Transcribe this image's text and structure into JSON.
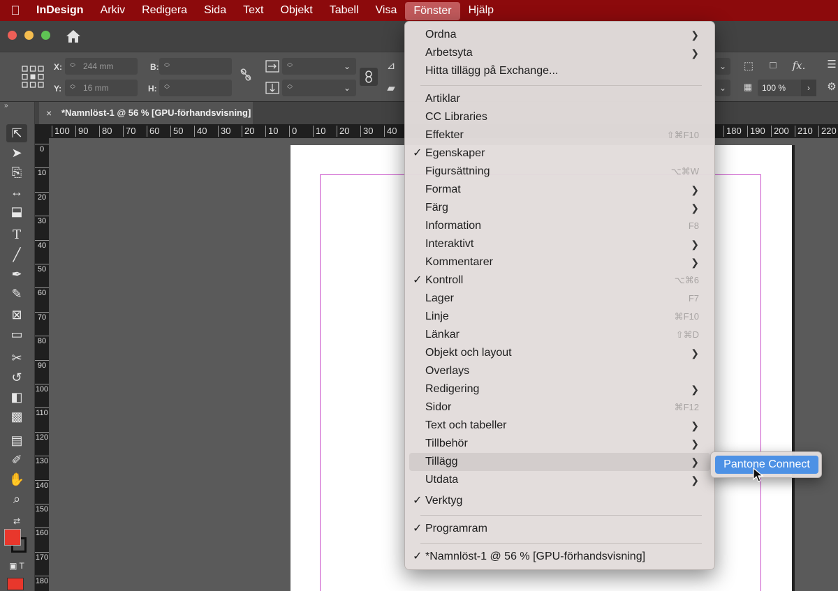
{
  "menubar": {
    "apple_icon": "apple-logo-icon",
    "app_name": "InDesign",
    "items": [
      "Arkiv",
      "Redigera",
      "Sida",
      "Text",
      "Objekt",
      "Tabell",
      "Visa",
      "Fönster",
      "Hjälp"
    ],
    "active": "Fönster"
  },
  "control": {
    "x_label": "X:",
    "x_value": "244 mm",
    "y_label": "Y:",
    "y_value": "16 mm",
    "b_label": "B:",
    "h_label": "H:",
    "zoom_value": "100 %"
  },
  "document_tab": {
    "close": "×",
    "title": "*Namnlöst-1 @ 56 % [GPU-förhandsvisning]"
  },
  "hruler": [
    "100",
    "90",
    "80",
    "70",
    "60",
    "50",
    "40",
    "30",
    "20",
    "10",
    "0",
    "10",
    "20",
    "30",
    "40",
    "180",
    "190",
    "200",
    "210",
    "220"
  ],
  "vruler": [
    "0",
    "10",
    "20",
    "30",
    "40",
    "50",
    "60",
    "70",
    "80",
    "90",
    "100",
    "110",
    "120",
    "130",
    "140",
    "150",
    "160",
    "170",
    "180"
  ],
  "window_menu": {
    "items": [
      {
        "label": "Ordna",
        "submenu": true
      },
      {
        "label": "Arbetsyta",
        "submenu": true
      },
      {
        "label": "Hitta tillägg på Exchange..."
      },
      {
        "label": "Artiklar"
      },
      {
        "label": "CC Libraries"
      },
      {
        "label": "Effekter",
        "shortcut": "⇧⌘F10"
      },
      {
        "label": "Egenskaper",
        "checked": true
      },
      {
        "label": "Figursättning",
        "shortcut": "⌥⌘W"
      },
      {
        "label": "Format",
        "submenu": true
      },
      {
        "label": "Färg",
        "submenu": true
      },
      {
        "label": "Information",
        "shortcut": "F8"
      },
      {
        "label": "Interaktivt",
        "submenu": true
      },
      {
        "label": "Kommentarer",
        "submenu": true
      },
      {
        "label": "Kontroll",
        "checked": true,
        "shortcut": "⌥⌘6"
      },
      {
        "label": "Lager",
        "shortcut": "F7"
      },
      {
        "label": "Linje",
        "shortcut": "⌘F10"
      },
      {
        "label": "Länkar",
        "shortcut": "⇧⌘D"
      },
      {
        "label": "Objekt och layout",
        "submenu": true
      },
      {
        "label": "Overlays"
      },
      {
        "label": "Redigering",
        "submenu": true
      },
      {
        "label": "Sidor",
        "shortcut": "⌘F12"
      },
      {
        "label": "Text och tabeller",
        "submenu": true
      },
      {
        "label": "Tillbehör",
        "submenu": true
      },
      {
        "label": "Tillägg",
        "submenu": true,
        "highlighted": true
      },
      {
        "label": "Utdata",
        "submenu": true
      },
      {
        "label": "Verktyg",
        "checked": true
      },
      {
        "label": "Programram",
        "checked": true
      },
      {
        "label": "*Namnlöst-1 @ 56 % [GPU-förhandsvisning]",
        "checked": true
      }
    ]
  },
  "submenu": {
    "item": "Pantone Connect"
  },
  "colors": {
    "menubar": "#8c0a0c",
    "highlight": "#4d91e5",
    "fill_swatch": "#e8372c",
    "margin_guide": "#c94fc9"
  }
}
